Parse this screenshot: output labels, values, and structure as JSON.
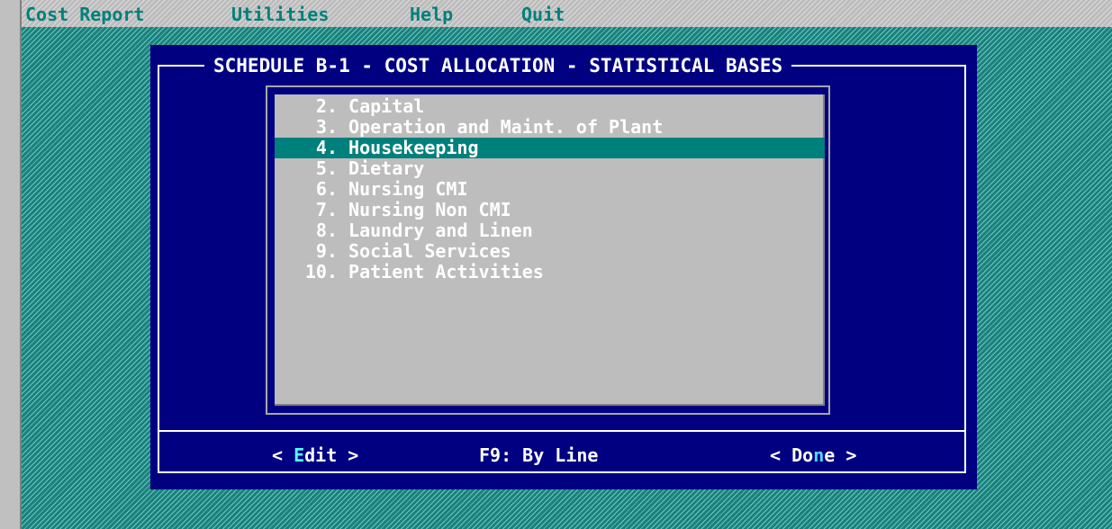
{
  "menu": {
    "items": [
      {
        "label": "Cost Report"
      },
      {
        "label": "Utilities"
      },
      {
        "label": "Help"
      },
      {
        "label": "Quit"
      }
    ]
  },
  "dialog": {
    "title": "SCHEDULE B-1 - COST ALLOCATION - STATISTICAL BASES",
    "list": {
      "selected_index": 2,
      "items": [
        {
          "num": "2.",
          "label": "Capital"
        },
        {
          "num": "3.",
          "label": "Operation and Maint. of Plant"
        },
        {
          "num": "4.",
          "label": "Housekeeping"
        },
        {
          "num": "5.",
          "label": "Dietary"
        },
        {
          "num": "6.",
          "label": "Nursing CMI"
        },
        {
          "num": "7.",
          "label": "Nursing Non CMI"
        },
        {
          "num": "8.",
          "label": "Laundry and Linen"
        },
        {
          "num": "9.",
          "label": "Social Services"
        },
        {
          "num": "10.",
          "label": "Patient Activities"
        }
      ]
    },
    "buttons": {
      "edit": {
        "open": "< ",
        "hotkey": "E",
        "rest": "dit",
        "close": " >"
      },
      "by_line": {
        "label": "F9: By Line"
      },
      "done": {
        "open": "< ",
        "pre": "Do",
        "hotkey": "n",
        "rest": "e",
        "close": " >"
      }
    }
  },
  "colors": {
    "desktop": "#2f9a95",
    "dialog_bg": "#000080",
    "list_bg": "#bdbdbd",
    "selection": "#00807c",
    "menu_text": "#00807c",
    "hotkey": "#55ffff"
  }
}
